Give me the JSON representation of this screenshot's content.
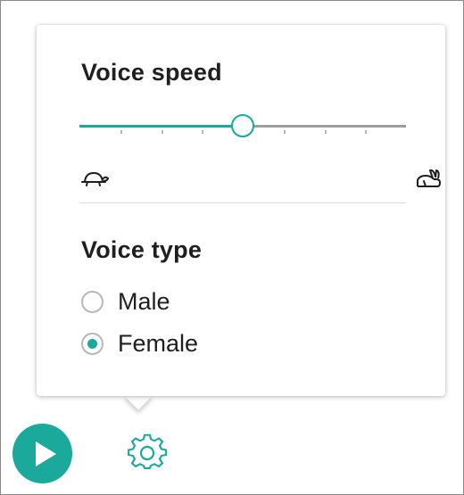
{
  "voice_speed": {
    "title": "Voice speed",
    "value": 0.5,
    "tick_count": 7,
    "slow_icon": "turtle-icon",
    "fast_icon": "rabbit-icon"
  },
  "voice_type": {
    "title": "Voice type",
    "options": [
      {
        "label": "Male",
        "selected": false
      },
      {
        "label": "Female",
        "selected": true
      }
    ]
  },
  "controls": {
    "play_icon": "play-icon",
    "settings_icon": "gear-icon"
  },
  "colors": {
    "accent": "#1aa99b",
    "track": "#9e9e9e",
    "text": "#1f1f1f"
  }
}
